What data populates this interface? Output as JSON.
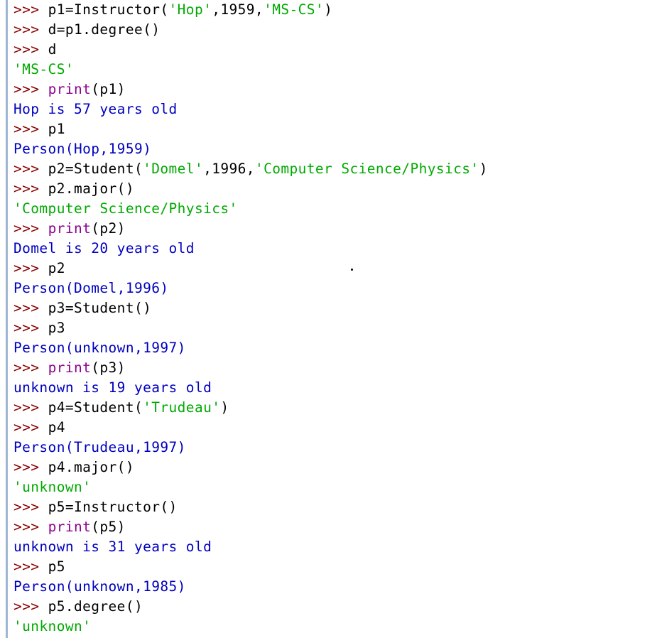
{
  "console": {
    "prompt": ">>>",
    "lines": [
      {
        "type": "input",
        "parts": [
          {
            "cls": "code",
            "text": "p1=Instructor("
          },
          {
            "cls": "str",
            "text": "'Hop'"
          },
          {
            "cls": "code",
            "text": ",1959,"
          },
          {
            "cls": "str",
            "text": "'MS-CS'"
          },
          {
            "cls": "code",
            "text": ")"
          }
        ]
      },
      {
        "type": "input",
        "parts": [
          {
            "cls": "code",
            "text": "d=p1.degree()"
          }
        ]
      },
      {
        "type": "input",
        "parts": [
          {
            "cls": "code",
            "text": "d"
          }
        ]
      },
      {
        "type": "result",
        "text": "'MS-CS'"
      },
      {
        "type": "input",
        "parts": [
          {
            "cls": "kw",
            "text": "print"
          },
          {
            "cls": "code",
            "text": "(p1)"
          }
        ]
      },
      {
        "type": "output",
        "text": "Hop is 57 years old"
      },
      {
        "type": "input",
        "parts": [
          {
            "cls": "code",
            "text": "p1"
          }
        ]
      },
      {
        "type": "output",
        "text": "Person(Hop,1959)"
      },
      {
        "type": "input",
        "parts": [
          {
            "cls": "code",
            "text": "p2=Student("
          },
          {
            "cls": "str",
            "text": "'Domel'"
          },
          {
            "cls": "code",
            "text": ",1996,"
          },
          {
            "cls": "str",
            "text": "'Computer Science/Physics'"
          },
          {
            "cls": "code",
            "text": ")"
          }
        ]
      },
      {
        "type": "input",
        "parts": [
          {
            "cls": "code",
            "text": "p2.major()"
          }
        ]
      },
      {
        "type": "result",
        "text": "'Computer Science/Physics'"
      },
      {
        "type": "input",
        "parts": [
          {
            "cls": "kw",
            "text": "print"
          },
          {
            "cls": "code",
            "text": "(p2)"
          }
        ]
      },
      {
        "type": "output",
        "text": "Domel is 20 years old"
      },
      {
        "type": "input",
        "parts": [
          {
            "cls": "code",
            "text": "p2"
          }
        ]
      },
      {
        "type": "output",
        "text": "Person(Domel,1996)"
      },
      {
        "type": "input",
        "parts": [
          {
            "cls": "code",
            "text": "p3=Student()"
          }
        ]
      },
      {
        "type": "input",
        "parts": [
          {
            "cls": "code",
            "text": "p3"
          }
        ]
      },
      {
        "type": "output",
        "text": "Person(unknown,1997)"
      },
      {
        "type": "input",
        "parts": [
          {
            "cls": "kw",
            "text": "print"
          },
          {
            "cls": "code",
            "text": "(p3)"
          }
        ]
      },
      {
        "type": "output",
        "text": "unknown is 19 years old"
      },
      {
        "type": "input",
        "parts": [
          {
            "cls": "code",
            "text": "p4=Student("
          },
          {
            "cls": "str",
            "text": "'Trudeau'"
          },
          {
            "cls": "code",
            "text": ")"
          }
        ]
      },
      {
        "type": "input",
        "parts": [
          {
            "cls": "code",
            "text": "p4"
          }
        ]
      },
      {
        "type": "output",
        "text": "Person(Trudeau,1997)"
      },
      {
        "type": "input",
        "parts": [
          {
            "cls": "code",
            "text": "p4.major()"
          }
        ]
      },
      {
        "type": "result",
        "text": "'unknown'"
      },
      {
        "type": "input",
        "parts": [
          {
            "cls": "code",
            "text": "p5=Instructor()"
          }
        ]
      },
      {
        "type": "input",
        "parts": [
          {
            "cls": "kw",
            "text": "print"
          },
          {
            "cls": "code",
            "text": "(p5)"
          }
        ]
      },
      {
        "type": "output",
        "text": "unknown is 31 years old"
      },
      {
        "type": "input",
        "parts": [
          {
            "cls": "code",
            "text": "p5"
          }
        ]
      },
      {
        "type": "output",
        "text": "Person(unknown,1985)"
      },
      {
        "type": "input",
        "parts": [
          {
            "cls": "code",
            "text": "p5.degree()"
          }
        ]
      },
      {
        "type": "result",
        "text": "'unknown'"
      }
    ]
  },
  "colors": {
    "prompt": "#8b0000",
    "string": "#00aa00",
    "keyword": "#900090",
    "output": "#0000c0",
    "gutter": "#9fb6d3"
  }
}
